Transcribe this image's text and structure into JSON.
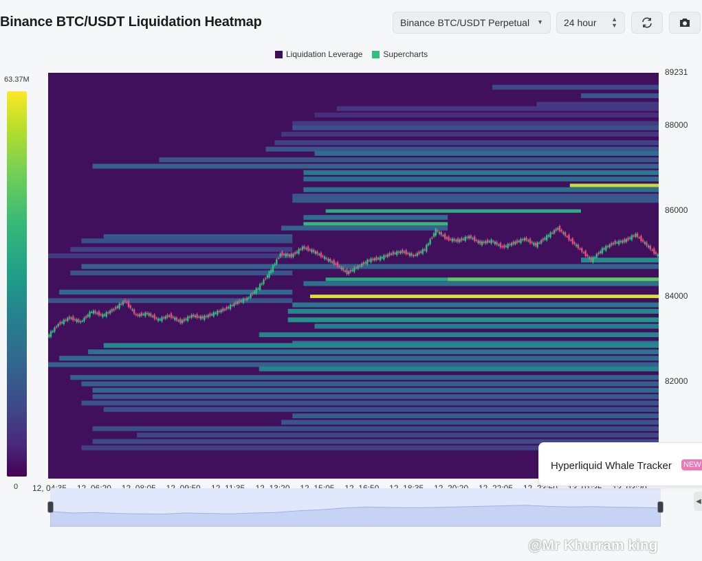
{
  "header": {
    "title": "Binance BTC/USDT Liquidation Heatmap",
    "pair_select": "Binance BTC/USDT Perpetual",
    "range_select": "24 hour",
    "refresh_icon": "refresh-icon",
    "camera_icon": "camera-icon"
  },
  "legend": [
    {
      "label": "Liquidation Leverage",
      "color": "#3b0f5a"
    },
    {
      "label": "Supercharts",
      "color": "#2fbf7f"
    }
  ],
  "colorbar": {
    "max_label": "63.37M",
    "min_label": "0"
  },
  "toast": {
    "text": "Hyperliquid Whale Tracker",
    "badge": "NEW"
  },
  "watermark": "@Mr Khurram king",
  "chart_data": {
    "type": "heatmap",
    "title": "Binance BTC/USDT Liquidation Heatmap",
    "x_ticks": [
      "12, 04:35",
      "12, 06:20",
      "12, 08:05",
      "12, 09:50",
      "12, 11:35",
      "12, 13:20",
      "12, 15:05",
      "12, 16:50",
      "12, 18:35",
      "12, 20:20",
      "12, 22:05",
      "12, 23:50",
      "13, 01:35",
      "13, 03:20"
    ],
    "y_ticks": [
      "89231",
      "88000",
      "86000",
      "84000",
      "82000"
    ],
    "ylim": [
      80250,
      89231
    ],
    "colorscale": {
      "min": 0,
      "max": 63370000,
      "unit": "USD",
      "colormap": "viridis"
    },
    "price_series": [
      {
        "t": 0,
        "p": 83050
      },
      {
        "t": 0.5,
        "p": 83350
      },
      {
        "t": 1,
        "p": 83500
      },
      {
        "t": 1.5,
        "p": 83400
      },
      {
        "t": 2,
        "p": 83650
      },
      {
        "t": 2.5,
        "p": 83550
      },
      {
        "t": 3,
        "p": 83700
      },
      {
        "t": 3.5,
        "p": 83900
      },
      {
        "t": 4,
        "p": 83550
      },
      {
        "t": 4.5,
        "p": 83600
      },
      {
        "t": 5,
        "p": 83450
      },
      {
        "t": 5.5,
        "p": 83550
      },
      {
        "t": 6,
        "p": 83400
      },
      {
        "t": 6.5,
        "p": 83550
      },
      {
        "t": 7,
        "p": 83500
      },
      {
        "t": 7.5,
        "p": 83600
      },
      {
        "t": 8,
        "p": 83700
      },
      {
        "t": 8.5,
        "p": 83850
      },
      {
        "t": 9,
        "p": 83950
      },
      {
        "t": 9.5,
        "p": 84200
      },
      {
        "t": 10,
        "p": 84550
      },
      {
        "t": 10.5,
        "p": 85000
      },
      {
        "t": 11,
        "p": 84950
      },
      {
        "t": 11.5,
        "p": 85150
      },
      {
        "t": 12,
        "p": 85050
      },
      {
        "t": 12.5,
        "p": 84900
      },
      {
        "t": 13,
        "p": 84750
      },
      {
        "t": 13.5,
        "p": 84550
      },
      {
        "t": 14,
        "p": 84700
      },
      {
        "t": 14.5,
        "p": 84850
      },
      {
        "t": 15,
        "p": 84900
      },
      {
        "t": 15.5,
        "p": 85000
      },
      {
        "t": 16,
        "p": 85050
      },
      {
        "t": 16.5,
        "p": 84950
      },
      {
        "t": 17,
        "p": 85100
      },
      {
        "t": 17.5,
        "p": 85550
      },
      {
        "t": 18,
        "p": 85350
      },
      {
        "t": 18.5,
        "p": 85300
      },
      {
        "t": 19,
        "p": 85400
      },
      {
        "t": 19.5,
        "p": 85250
      },
      {
        "t": 20,
        "p": 85300
      },
      {
        "t": 20.5,
        "p": 85150
      },
      {
        "t": 21,
        "p": 85250
      },
      {
        "t": 21.5,
        "p": 85350
      },
      {
        "t": 22,
        "p": 85200
      },
      {
        "t": 22.5,
        "p": 85400
      },
      {
        "t": 23,
        "p": 85600
      },
      {
        "t": 23.5,
        "p": 85350
      },
      {
        "t": 24,
        "p": 85100
      },
      {
        "t": 24.5,
        "p": 84850
      },
      {
        "t": 25,
        "p": 85100
      },
      {
        "t": 25.5,
        "p": 85250
      },
      {
        "t": 26,
        "p": 85300
      },
      {
        "t": 26.5,
        "p": 85450
      },
      {
        "t": 27,
        "p": 85200
      },
      {
        "t": 27.5,
        "p": 84950
      }
    ],
    "time_max": 27.5,
    "liquidation_bands": [
      {
        "price": 88900,
        "t_start": 20,
        "t_end": 27.5,
        "level": 0.25
      },
      {
        "price": 88700,
        "t_start": 24,
        "t_end": 27.5,
        "level": 0.3
      },
      {
        "price": 88500,
        "t_start": 22,
        "t_end": 27.5,
        "level": 0.2
      },
      {
        "price": 88400,
        "t_start": 13,
        "t_end": 27.5,
        "level": 0.18
      },
      {
        "price": 88250,
        "t_start": 12,
        "t_end": 27.5,
        "level": 0.15
      },
      {
        "price": 88050,
        "t_start": 11,
        "t_end": 27.5,
        "level": 0.2
      },
      {
        "price": 87950,
        "t_start": 11,
        "t_end": 27.5,
        "level": 0.28
      },
      {
        "price": 87800,
        "t_start": 10.5,
        "t_end": 27.5,
        "level": 0.18
      },
      {
        "price": 87600,
        "t_start": 10.2,
        "t_end": 27.5,
        "level": 0.22
      },
      {
        "price": 87450,
        "t_start": 9.8,
        "t_end": 27.5,
        "level": 0.3
      },
      {
        "price": 87350,
        "t_start": 12,
        "t_end": 27.5,
        "level": 0.4
      },
      {
        "price": 87200,
        "t_start": 5,
        "t_end": 27.5,
        "level": 0.3
      },
      {
        "price": 87050,
        "t_start": 2,
        "t_end": 27.5,
        "level": 0.35
      },
      {
        "price": 86900,
        "t_start": 11.5,
        "t_end": 27.5,
        "level": 0.45
      },
      {
        "price": 86750,
        "t_start": 11.5,
        "t_end": 27.5,
        "level": 0.4
      },
      {
        "price": 86600,
        "t_start": 23.5,
        "t_end": 27.5,
        "level": 0.95
      },
      {
        "price": 86500,
        "t_start": 11.5,
        "t_end": 27.5,
        "level": 0.42
      },
      {
        "price": 86350,
        "t_start": 11,
        "t_end": 27.5,
        "level": 0.3
      },
      {
        "price": 86250,
        "t_start": 11,
        "t_end": 27.5,
        "level": 0.32
      },
      {
        "price": 86000,
        "t_start": 12.5,
        "t_end": 24,
        "level": 0.7
      },
      {
        "price": 85850,
        "t_start": 11.5,
        "t_end": 18,
        "level": 0.4
      },
      {
        "price": 85700,
        "t_start": 11.5,
        "t_end": 18,
        "level": 0.75
      },
      {
        "price": 85600,
        "t_start": 10.5,
        "t_end": 18,
        "level": 0.35
      },
      {
        "price": 85400,
        "t_start": 2.5,
        "t_end": 11,
        "level": 0.32
      },
      {
        "price": 85300,
        "t_start": 1.5,
        "t_end": 11,
        "level": 0.28
      },
      {
        "price": 85100,
        "t_start": 1,
        "t_end": 11,
        "level": 0.22
      },
      {
        "price": 84950,
        "t_start": 0,
        "t_end": 11,
        "level": 0.2
      },
      {
        "price": 84850,
        "t_start": 24,
        "t_end": 27.5,
        "level": 0.55
      },
      {
        "price": 84700,
        "t_start": 1.5,
        "t_end": 27.5,
        "level": 0.35
      },
      {
        "price": 84550,
        "t_start": 1,
        "t_end": 11,
        "level": 0.3
      },
      {
        "price": 84400,
        "t_start": 12.5,
        "t_end": 27.5,
        "level": 0.68
      },
      {
        "price": 84400,
        "t_start": 18,
        "t_end": 27.5,
        "level": 0.85
      },
      {
        "price": 84300,
        "t_start": 11.5,
        "t_end": 27.5,
        "level": 0.42
      },
      {
        "price": 84100,
        "t_start": 0.5,
        "t_end": 11,
        "level": 0.38
      },
      {
        "price": 84000,
        "t_start": 11.8,
        "t_end": 27.5,
        "level": 0.97
      },
      {
        "price": 83900,
        "t_start": 0,
        "t_end": 11,
        "level": 0.3
      },
      {
        "price": 83800,
        "t_start": 11,
        "t_end": 27.5,
        "level": 0.45
      },
      {
        "price": 83650,
        "t_start": 10.8,
        "t_end": 27.5,
        "level": 0.52
      },
      {
        "price": 83450,
        "t_start": 10.8,
        "t_end": 27.5,
        "level": 0.58
      },
      {
        "price": 83300,
        "t_start": 12,
        "t_end": 27.5,
        "level": 0.48
      },
      {
        "price": 83100,
        "t_start": 9.5,
        "t_end": 27.5,
        "level": 0.5
      },
      {
        "price": 82900,
        "t_start": 11,
        "t_end": 27.5,
        "level": 0.45
      },
      {
        "price": 82850,
        "t_start": 2.5,
        "t_end": 27.5,
        "level": 0.52
      },
      {
        "price": 82700,
        "t_start": 1.8,
        "t_end": 27.5,
        "level": 0.42
      },
      {
        "price": 82550,
        "t_start": 0.5,
        "t_end": 27.5,
        "level": 0.38
      },
      {
        "price": 82400,
        "t_start": 0,
        "t_end": 27.5,
        "level": 0.35
      },
      {
        "price": 82300,
        "t_start": 9.5,
        "t_end": 27.5,
        "level": 0.5
      },
      {
        "price": 82100,
        "t_start": 1,
        "t_end": 27.5,
        "level": 0.36
      },
      {
        "price": 81950,
        "t_start": 1.5,
        "t_end": 27.5,
        "level": 0.34
      },
      {
        "price": 81800,
        "t_start": 2,
        "t_end": 27.5,
        "level": 0.38
      },
      {
        "price": 81650,
        "t_start": 2,
        "t_end": 27.5,
        "level": 0.32
      },
      {
        "price": 81500,
        "t_start": 1.5,
        "t_end": 27.5,
        "level": 0.3
      },
      {
        "price": 81350,
        "t_start": 2.5,
        "t_end": 27.5,
        "level": 0.28
      },
      {
        "price": 81200,
        "t_start": 11,
        "t_end": 27.5,
        "level": 0.34
      },
      {
        "price": 81050,
        "t_start": 10.5,
        "t_end": 27.5,
        "level": 0.3
      },
      {
        "price": 80900,
        "t_start": 2,
        "t_end": 27.5,
        "level": 0.28
      },
      {
        "price": 80750,
        "t_start": 4,
        "t_end": 27.5,
        "level": 0.24
      },
      {
        "price": 80600,
        "t_start": 2,
        "t_end": 27.5,
        "level": 0.26
      },
      {
        "price": 80450,
        "t_start": 1.5,
        "t_end": 27.5,
        "level": 0.22
      }
    ],
    "navigator_series": [
      0.55,
      0.5,
      0.52,
      0.48,
      0.47,
      0.46,
      0.5,
      0.48,
      0.47,
      0.5,
      0.52,
      0.58,
      0.62,
      0.68,
      0.72,
      0.7,
      0.69,
      0.7,
      0.72,
      0.74,
      0.76,
      0.78,
      0.74,
      0.72,
      0.73,
      0.71,
      0.7,
      0.68
    ]
  }
}
